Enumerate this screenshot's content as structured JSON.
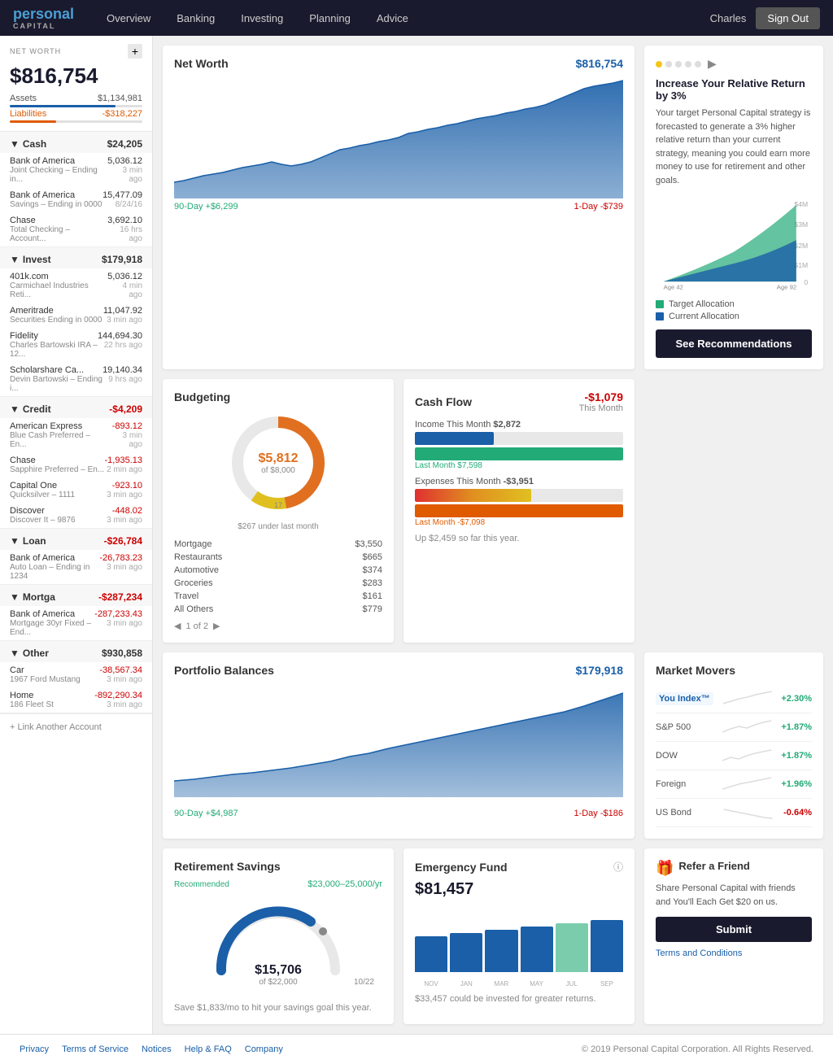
{
  "navbar": {
    "logo_main": "personal",
    "logo_sub": "CAPITAL",
    "links": [
      "Overview",
      "Banking",
      "Investing",
      "Planning",
      "Advice"
    ],
    "user": "Charles",
    "signout": "Sign Out"
  },
  "sidebar": {
    "section_label": "NET WORTH",
    "add_btn": "+",
    "total": "$816,754",
    "assets_label": "Assets",
    "assets_value": "$1,134,981",
    "liab_label": "Liabilities",
    "liab_value": "-$318,227",
    "sections": [
      {
        "title": "Cash",
        "amount": "$24,205",
        "negative": false,
        "accounts": [
          {
            "name": "Bank of America",
            "sub": "Joint Checking – Ending in...",
            "amount": "5,036.12",
            "time": "3 min ago",
            "negative": false
          },
          {
            "name": "Bank of America",
            "sub": "Savings – Ending in 0000",
            "amount": "15,477.09",
            "time": "8/24/16",
            "negative": false
          },
          {
            "name": "Chase",
            "sub": "Total Checking – Account...",
            "amount": "3,692.10",
            "time": "16 hrs ago",
            "negative": false
          }
        ]
      },
      {
        "title": "Invest",
        "amount": "$179,918",
        "negative": false,
        "accounts": [
          {
            "name": "401k.com",
            "sub": "Carmichael Industries Reti...",
            "amount": "5,036.12",
            "time": "4 min ago",
            "negative": false
          },
          {
            "name": "Ameritrade",
            "sub": "Securities Ending in 0000",
            "amount": "11,047.92",
            "time": "3 min ago",
            "negative": false
          },
          {
            "name": "Fidelity",
            "sub": "Charles Bartowski IRA – 12...",
            "amount": "144,694.30",
            "time": "22 hrs ago",
            "negative": false
          },
          {
            "name": "Scholarshare Ca...",
            "sub": "Devin Bartowski – Ending i...",
            "amount": "19,140.34",
            "time": "9 hrs ago",
            "negative": false
          }
        ]
      },
      {
        "title": "Credit",
        "amount": "-$4,209",
        "negative": true,
        "accounts": [
          {
            "name": "American Express",
            "sub": "Blue Cash Preferred – En...",
            "amount": "-893.12",
            "time": "3 min ago",
            "negative": true
          },
          {
            "name": "Chase",
            "sub": "Sapphire Preferred – En...",
            "amount": "-1,935.13",
            "time": "2 min ago",
            "negative": true
          },
          {
            "name": "Capital One",
            "sub": "Quicksilver – 1111",
            "amount": "-923.10",
            "time": "3 min ago",
            "negative": true
          },
          {
            "name": "Discover",
            "sub": "Discover It – 9876",
            "amount": "-448.02",
            "time": "3 min ago",
            "negative": true
          }
        ]
      },
      {
        "title": "Loan",
        "amount": "-$26,784",
        "negative": true,
        "accounts": [
          {
            "name": "Bank of America",
            "sub": "Auto Loan – Ending in 1234",
            "amount": "-26,783.23",
            "time": "3 min ago",
            "negative": true
          }
        ]
      },
      {
        "title": "Mortga",
        "amount": "-$287,234",
        "negative": true,
        "accounts": [
          {
            "name": "Bank of America",
            "sub": "Mortgage 30yr Fixed – End...",
            "amount": "-287,233.43",
            "time": "3 min ago",
            "negative": true
          }
        ]
      },
      {
        "title": "Other",
        "amount": "$930,858",
        "negative": false,
        "accounts": [
          {
            "name": "Car",
            "sub": "1967 Ford Mustang",
            "amount": "-38,567.34",
            "time": "3 min ago",
            "negative": true
          },
          {
            "name": "Home",
            "sub": "186 Fleet St",
            "amount": "-892,290.34",
            "time": "3 min ago",
            "negative": true
          }
        ]
      }
    ],
    "link_account": "+ Link Another Account"
  },
  "net_worth": {
    "title": "Net Worth",
    "value": "$816,754",
    "period_90": "90-Day +$6,299",
    "period_1d": "1-Day -$739"
  },
  "budgeting": {
    "title": "Budgeting",
    "donut_amount": "$5,812",
    "donut_of": "of $8,000",
    "donut_under": "$267 under last month",
    "items": [
      {
        "label": "Mortgage",
        "amount": "$3,550"
      },
      {
        "label": "Restaurants",
        "amount": "$665"
      },
      {
        "label": "Automotive",
        "amount": "$374"
      },
      {
        "label": "Groceries",
        "amount": "$283"
      },
      {
        "label": "Travel",
        "amount": "$161"
      },
      {
        "label": "All Others",
        "amount": "$779"
      }
    ],
    "pagination": "1 of 2"
  },
  "cashflow": {
    "title": "Cash Flow",
    "value": "-$1,079",
    "subtitle": "This Month",
    "income_label": "Income This Month",
    "income_value": "$2,872",
    "income_last": "Last Month $7,598",
    "expense_label": "Expenses This Month",
    "expense_value": "-$3,951",
    "expense_last": "Last Month -$7,098",
    "ytd": "Up $2,459 so far this year."
  },
  "promo": {
    "title": "Increase Your Relative Return by 3%",
    "text": "Your target Personal Capital strategy is forecasted to generate a 3% higher relative return than your current strategy, meaning you could earn more money to use for retirement and other goals.",
    "legend_target": "Target Allocation",
    "legend_current": "Current Allocation",
    "axis_left": "$4M",
    "axis_m3": "$3M",
    "axis_m2": "$2M",
    "axis_m1": "$1M",
    "axis_0": "0",
    "age_left": "Age 42",
    "age_right": "Age 92",
    "btn": "See Recommendations"
  },
  "portfolio": {
    "title": "Portfolio Balances",
    "value": "$179,918",
    "period_90": "90-Day +$4,987",
    "period_1d": "1-Day -$186"
  },
  "market_movers": {
    "title": "Market Movers",
    "items": [
      {
        "name": "You Index™",
        "change": "+2.30%",
        "up": true
      },
      {
        "name": "S&P 500",
        "change": "+1.87%",
        "up": true
      },
      {
        "name": "DOW",
        "change": "+1.87%",
        "up": true
      },
      {
        "name": "Foreign",
        "change": "+1.96%",
        "up": true
      },
      {
        "name": "US Bond",
        "change": "-0.64%",
        "up": false
      }
    ]
  },
  "retirement": {
    "title": "Retirement Savings",
    "rec_label": "Recommended",
    "rec_value": "$23,000–25,000/yr",
    "amount": "$15,706",
    "of": "of $22,000",
    "date": "10/22",
    "save_text": "Save $1,833/mo to hit your savings goal this year."
  },
  "emergency": {
    "title": "Emergency Fund",
    "value": "$81,457",
    "note": "$33,457 could be invested for greater returns.",
    "months": [
      "NOV",
      "JAN",
      "MAR",
      "MAY",
      "JUL",
      "SEP"
    ]
  },
  "refer": {
    "title": "Refer a Friend",
    "text": "Share Personal Capital with friends and You'll Each Get $20 on us.",
    "btn": "Submit",
    "terms": "Terms and Conditions"
  },
  "footer": {
    "links": [
      "Privacy",
      "Terms of Service",
      "Notices",
      "Help & FAQ",
      "Company"
    ],
    "copy": "© 2019 Personal Capital Corporation. All Rights Reserved."
  }
}
